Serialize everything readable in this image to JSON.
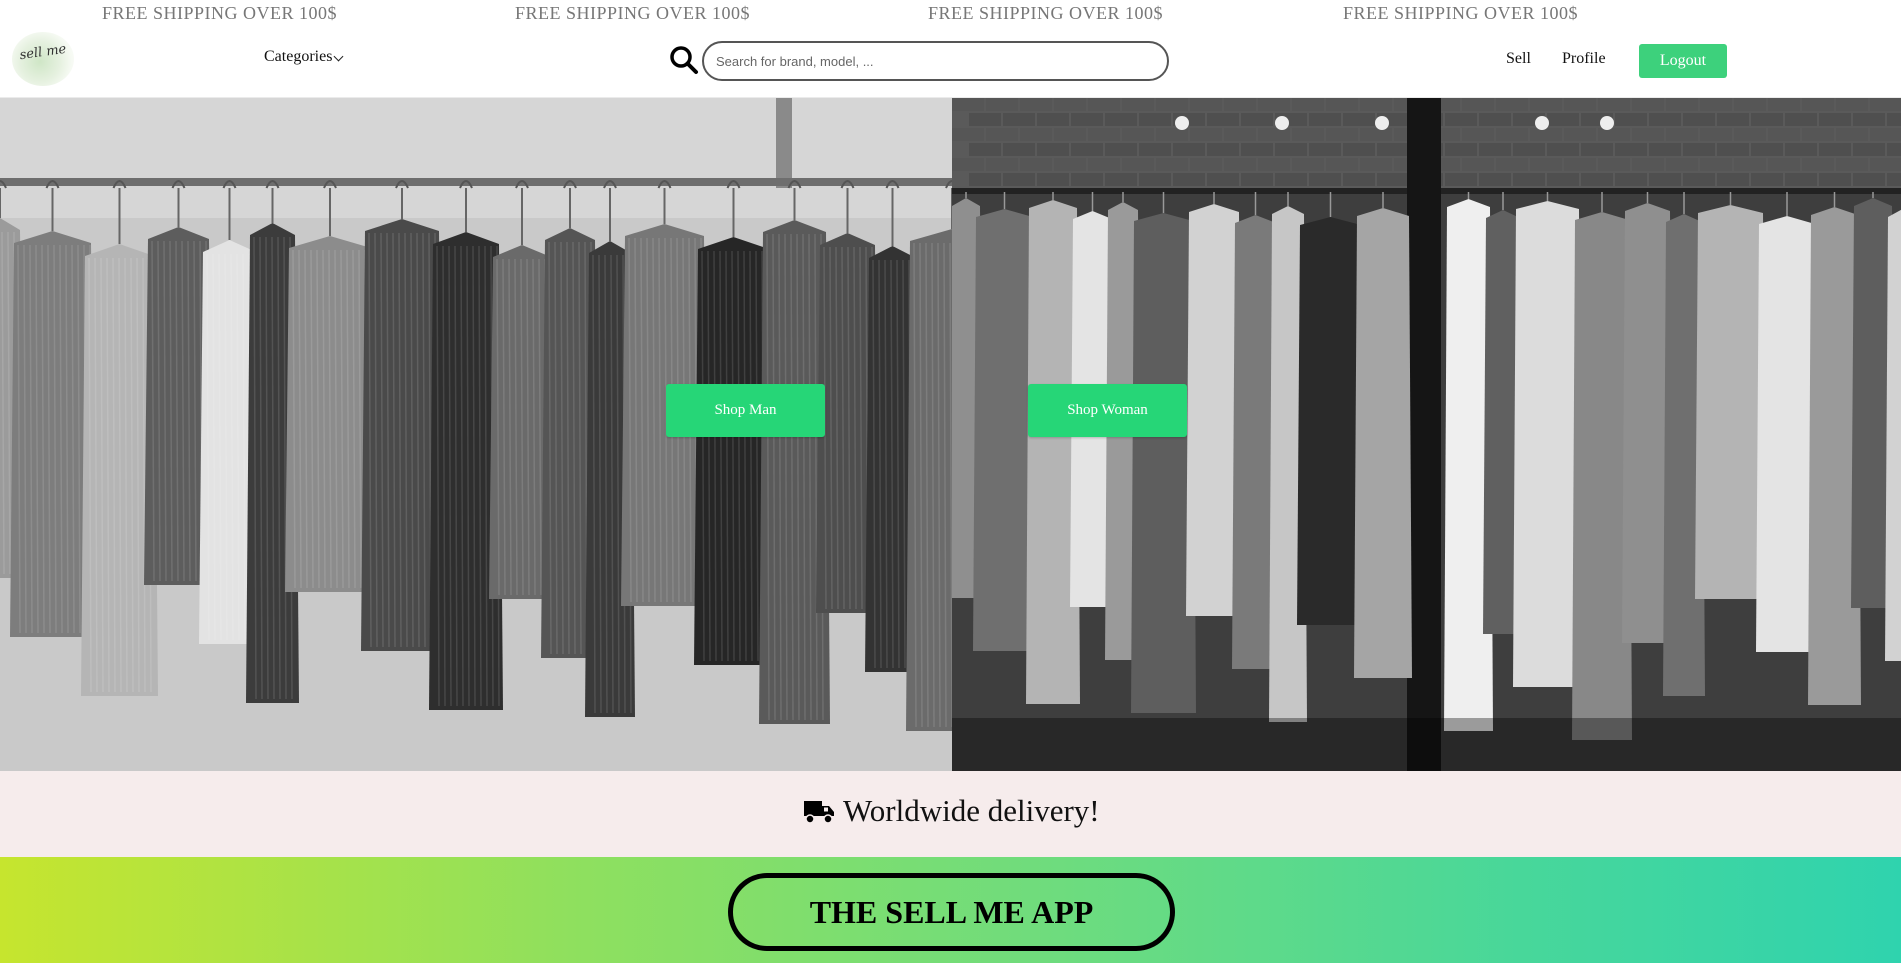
{
  "promo": {
    "items": [
      "FREE SHIPPING OVER 100$",
      "FREE SHIPPING OVER 100$",
      "FREE SHIPPING OVER 100$",
      "FREE SHIPPING OVER 100$"
    ]
  },
  "header": {
    "logo_text": "sell me",
    "categories_label": "Categories",
    "search": {
      "placeholder": "Search for brand, model, ...",
      "value": ""
    },
    "nav": {
      "sell": "Sell",
      "profile": "Profile",
      "logout": "Logout"
    }
  },
  "hero": {
    "shop_man_label": "Shop Man",
    "shop_woman_label": "Shop Woman"
  },
  "delivery": {
    "text": "Worldwide delivery!",
    "icon": "truck-icon"
  },
  "app_banner": {
    "label": "THE SELL ME APP"
  },
  "colors": {
    "accent_green": "#3dd17c",
    "shop_button_green": "#26d677",
    "delivery_band": "#f6ecec",
    "gradient_start": "#c6e52e",
    "gradient_end": "#2fd3ae"
  }
}
